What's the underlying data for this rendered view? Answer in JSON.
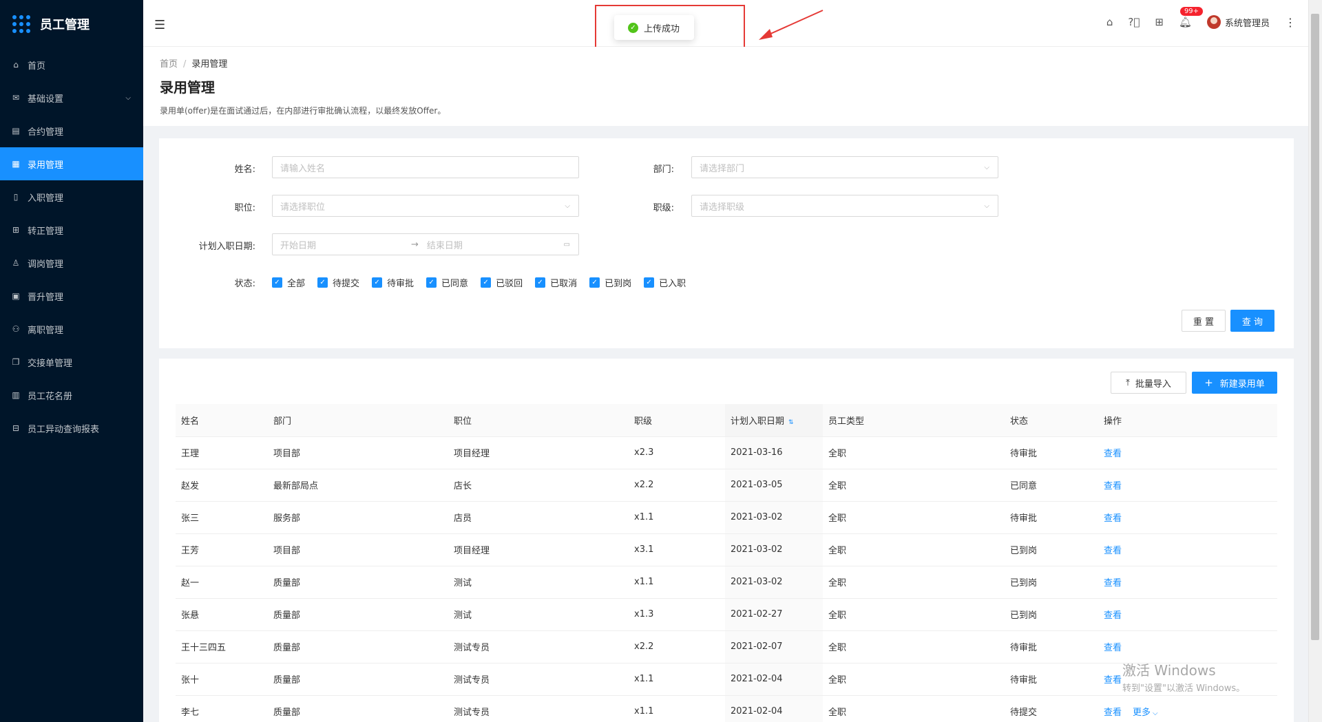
{
  "app": {
    "title": "员工管理"
  },
  "sidebar": {
    "items": [
      {
        "label": "首页",
        "icon": "home-icon",
        "active": false
      },
      {
        "label": "基础设置",
        "icon": "mail-icon",
        "active": false,
        "expandable": true
      },
      {
        "label": "合约管理",
        "icon": "calendar-icon",
        "active": false
      },
      {
        "label": "录用管理",
        "icon": "layout-icon",
        "active": true
      },
      {
        "label": "入职管理",
        "icon": "file-icon",
        "active": false
      },
      {
        "label": "转正管理",
        "icon": "grid-icon",
        "active": false
      },
      {
        "label": "调岗管理",
        "icon": "user-icon",
        "active": false
      },
      {
        "label": "晋升管理",
        "icon": "report-icon",
        "active": false
      },
      {
        "label": "离职管理",
        "icon": "user-leave-icon",
        "active": false
      },
      {
        "label": "交接单管理",
        "icon": "copy-icon",
        "active": false
      },
      {
        "label": "员工花名册",
        "icon": "roster-icon",
        "active": false
      },
      {
        "label": "员工异动查询报表",
        "icon": "table-icon",
        "active": false
      }
    ]
  },
  "header": {
    "badge": "99+",
    "user_name": "系统管理员"
  },
  "toast": {
    "message": "上传成功"
  },
  "page": {
    "breadcrumb": [
      "首页",
      "录用管理"
    ],
    "title": "录用管理",
    "description": "录用单(offer)是在面试通过后，在内部进行审批确认流程，以最终发放Offer。"
  },
  "filter": {
    "name_label": "姓名:",
    "name_placeholder": "请输入姓名",
    "dept_label": "部门:",
    "dept_placeholder": "请选择部门",
    "position_label": "职位:",
    "position_placeholder": "请选择职位",
    "level_label": "职级:",
    "level_placeholder": "请选择职级",
    "date_label": "计划入职日期:",
    "date_start_placeholder": "开始日期",
    "date_end_placeholder": "结束日期",
    "status_label": "状态:",
    "statuses": [
      "全部",
      "待提交",
      "待审批",
      "已同意",
      "已驳回",
      "已取消",
      "已到岗",
      "已入职"
    ],
    "reset_label": "重 置",
    "query_label": "查 询"
  },
  "table_actions": {
    "import_label": "批量导入",
    "new_label": "新建录用单"
  },
  "table": {
    "columns": [
      "姓名",
      "部门",
      "职位",
      "职级",
      "计划入职日期",
      "员工类型",
      "状态",
      "操作"
    ],
    "rows": [
      {
        "name": "王理",
        "dept": "项目部",
        "position": "项目经理",
        "level": "x2.3",
        "date": "2021-03-16",
        "type": "全职",
        "status": "待审批",
        "action": "查看"
      },
      {
        "name": "赵发",
        "dept": "最新部局点",
        "position": "店长",
        "level": "x2.2",
        "date": "2021-03-05",
        "type": "全职",
        "status": "已同意",
        "action": "查看"
      },
      {
        "name": "张三",
        "dept": "服务部",
        "position": "店员",
        "level": "x1.1",
        "date": "2021-03-02",
        "type": "全职",
        "status": "待审批",
        "action": "查看"
      },
      {
        "name": "王芳",
        "dept": "项目部",
        "position": "项目经理",
        "level": "x3.1",
        "date": "2021-03-02",
        "type": "全职",
        "status": "已到岗",
        "action": "查看"
      },
      {
        "name": "赵一",
        "dept": "质量部",
        "position": "测试",
        "level": "x1.1",
        "date": "2021-03-02",
        "type": "全职",
        "status": "已到岗",
        "action": "查看"
      },
      {
        "name": "张悬",
        "dept": "质量部",
        "position": "测试",
        "level": "x1.3",
        "date": "2021-02-27",
        "type": "全职",
        "status": "已到岗",
        "action": "查看"
      },
      {
        "name": "王十三四五",
        "dept": "质量部",
        "position": "测试专员",
        "level": "x2.2",
        "date": "2021-02-07",
        "type": "全职",
        "status": "待审批",
        "action": "查看"
      },
      {
        "name": "张十",
        "dept": "质量部",
        "position": "测试专员",
        "level": "x1.1",
        "date": "2021-02-04",
        "type": "全职",
        "status": "待审批",
        "action": "查看"
      },
      {
        "name": "李七",
        "dept": "质量部",
        "position": "测试专员",
        "level": "x1.1",
        "date": "2021-02-04",
        "type": "全职",
        "status": "待提交",
        "action": "查看",
        "more": "更多"
      }
    ]
  },
  "watermark": {
    "line1": "激活 Windows",
    "line2": "转到\"设置\"以激活 Windows。"
  },
  "colors": {
    "sidebar_bg": "#001529",
    "primary": "#1890ff",
    "success": "#52c41a",
    "annotation_red": "#e53935"
  }
}
